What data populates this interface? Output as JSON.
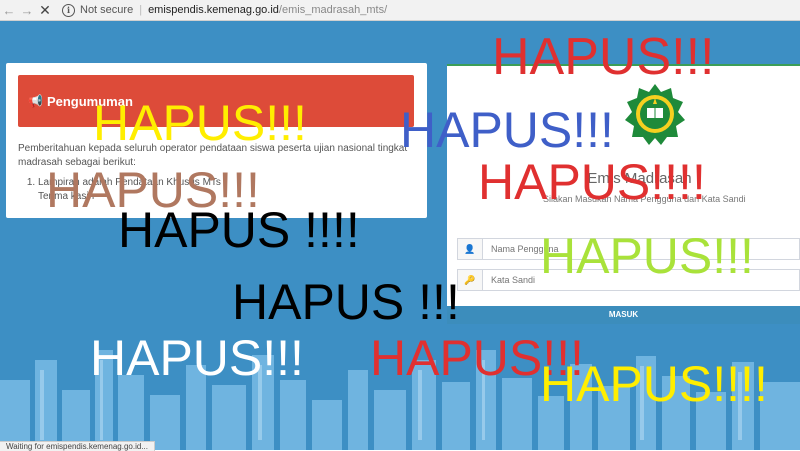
{
  "browser": {
    "security_label": "Not secure",
    "url_host": "emispendis.kemenag.go.id",
    "url_path": "/emis_madrasah_mts/",
    "status_text": "Waiting for emispendis.kemenag.go.id..."
  },
  "announcement": {
    "heading": "Pengumuman",
    "intro": "Pemberitahuan kepada seluruh operator pendataan siswa peserta ujian nasional tingkat madrasah sebagai berikut:",
    "items": [
      "Lampiran adalah Pendataan Khusus MTs"
    ],
    "closing": "Terima kasih"
  },
  "login": {
    "title": "Emis Madrasah",
    "subtitle": "Silakan Masukan Nama Pengguna dan Kata Sandi",
    "username_placeholder": "Nama Pengguna",
    "password_placeholder": "Kata Sandi",
    "submit_label": "MASUK"
  },
  "graffiti": [
    {
      "text": "HAPUS!!!",
      "color": "#e03030"
    },
    {
      "text": "HAPUS!!!",
      "color": "#ffee00"
    },
    {
      "text": "HAPUS!!!",
      "color": "#3f5fc8"
    },
    {
      "text": "HAPUS!!!!",
      "color": "#e03030"
    },
    {
      "text": "HAPUS!!!",
      "color": "#b07860"
    },
    {
      "text": "HAPUS !!!!",
      "color": "#000000"
    },
    {
      "text": "HAPUS!!!",
      "color": "#a9e23a"
    },
    {
      "text": "HAPUS !!!",
      "color": "#000000"
    },
    {
      "text": "HAPUS!!!",
      "color": "#ffffff"
    },
    {
      "text": "HAPUS!!!",
      "color": "#e03030"
    },
    {
      "text": "HAPUS!!!!",
      "color": "#ffee00"
    }
  ],
  "colors": {
    "page_bg": "#3d8fc4",
    "announcement_header": "#dd4b39",
    "login_button": "#3c8dbc"
  }
}
